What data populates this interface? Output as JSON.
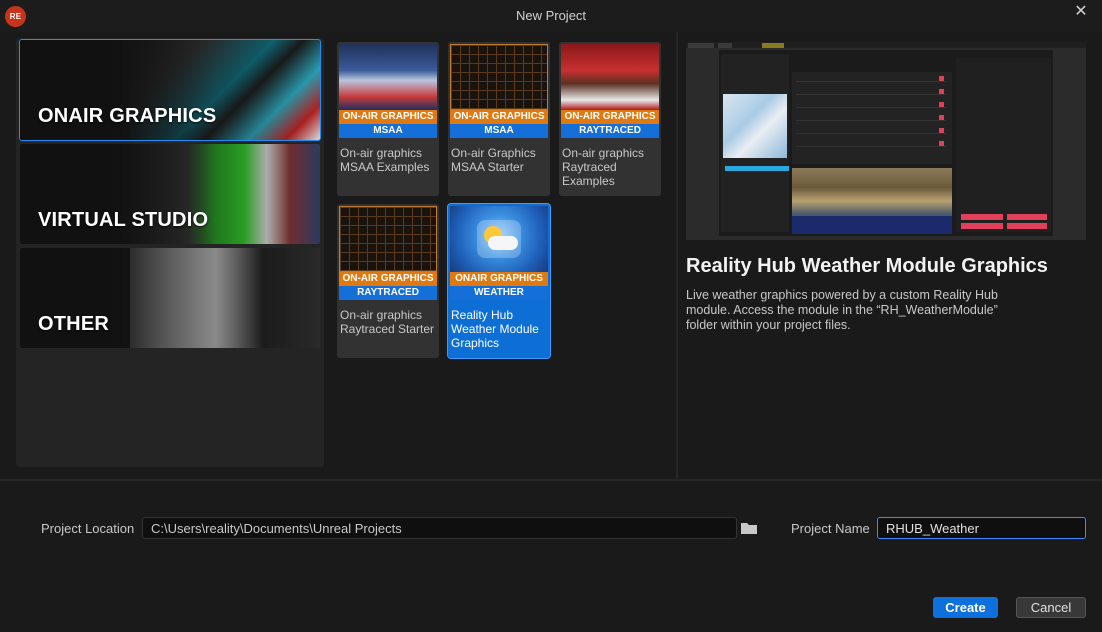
{
  "window": {
    "title": "New Project",
    "logo_text": "RE"
  },
  "categories": [
    {
      "label": "ONAIR GRAPHICS",
      "selected": true
    },
    {
      "label": "VIRTUAL STUDIO",
      "selected": false
    },
    {
      "label": "OTHER",
      "selected": false
    }
  ],
  "templates": [
    {
      "banner_top": "ON-AIR GRAPHICS",
      "banner_bottom": "MSAA",
      "name": "On-air graphics MSAA Examples",
      "selected": false
    },
    {
      "banner_top": "ON-AIR GRAPHICS",
      "banner_bottom": "MSAA",
      "name": "On-air Graphics MSAA Starter",
      "selected": false
    },
    {
      "banner_top": "ON-AIR GRAPHICS",
      "banner_bottom": "RAYTRACED",
      "name": "On-air graphics Raytraced Examples",
      "selected": false
    },
    {
      "banner_top": "ON-AIR GRAPHICS",
      "banner_bottom": "RAYTRACED",
      "name": "On-air graphics Raytraced Starter",
      "selected": false
    },
    {
      "banner_top": "ONAIR GRAPHICS",
      "banner_bottom": "WEATHER",
      "name": "Reality Hub Weather Module Graphics",
      "selected": true
    }
  ],
  "details": {
    "title": "Reality Hub Weather Module Graphics",
    "description": "Live weather graphics powered by a custom Reality Hub module. Access the module in the “RH_WeatherModule” folder within your project files."
  },
  "footer": {
    "location_label": "Project Location",
    "location_value": "C:\\Users\\reality\\Documents\\Unreal Projects",
    "name_label": "Project Name",
    "name_value": "RHUB_Weather",
    "create_label": "Create",
    "cancel_label": "Cancel"
  },
  "colors": {
    "accent": "#0e70dc",
    "banner_orange": "#e07a10",
    "banner_blue": "#1470d8",
    "logo_red": "#c8331c"
  }
}
